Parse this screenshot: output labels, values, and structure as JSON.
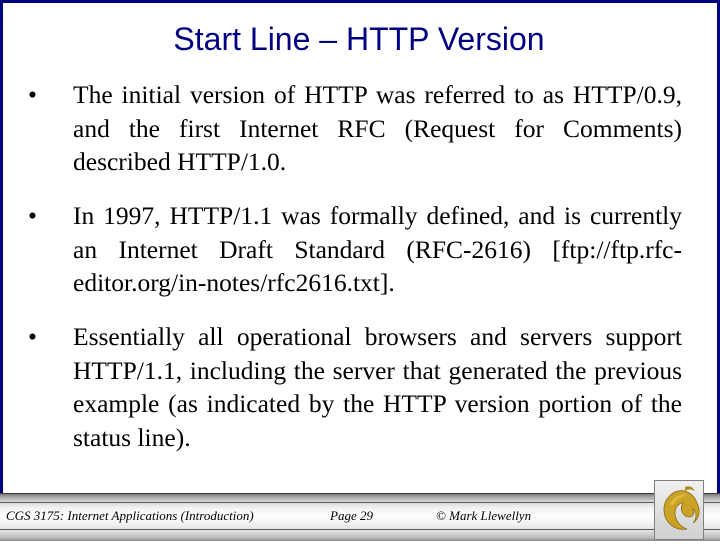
{
  "slide": {
    "title": "Start Line – HTTP Version",
    "bullets": [
      {
        "symbol": "•",
        "text": "The initial version of HTTP was referred to as HTTP/0.9, and the first Internet RFC (Request for Comments) described HTTP/1.0."
      },
      {
        "symbol": "•",
        "text": "In 1997, HTTP/1.1 was formally defined, and is currently an Internet Draft Standard (RFC-2616) [ftp://ftp.rfc-editor.org/in-notes/rfc2616.txt]."
      },
      {
        "symbol": "•",
        "text": "Essentially all operational browsers and servers support HTTP/1.1, including the server that generated the previous example (as indicated by the HTTP version portion of the status line)."
      }
    ]
  },
  "footer": {
    "course": "CGS 3175: Internet Applications (Introduction)",
    "page": "Page 29",
    "copyright": "© Mark Llewellyn",
    "logo_icon": "pegasus-logo-icon"
  },
  "colors": {
    "title": "#000080",
    "frame_border": "#000080",
    "logo_gold": "#c9a227"
  }
}
